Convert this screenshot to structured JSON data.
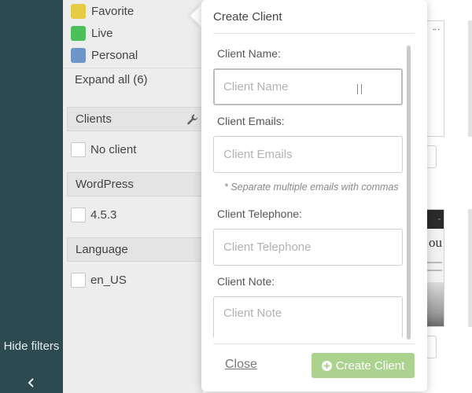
{
  "sidebar": {
    "hide_filters_label": "Hide filters",
    "hide_filters_icon": "chevron-left-icon"
  },
  "filters": {
    "tags": [
      {
        "label": "Favorite",
        "color": "#e6cc45"
      },
      {
        "label": "Live",
        "color": "#4dbf5a"
      },
      {
        "label": "Personal",
        "color": "#6f94c7"
      }
    ],
    "expand_all_label": "Expand all (6)",
    "sections": [
      {
        "title": "Clients",
        "icon": "wrench-icon",
        "options": [
          "No client"
        ]
      },
      {
        "title": "WordPress",
        "options": [
          "4.5.3"
        ]
      },
      {
        "title": "Language",
        "options": [
          "en_US"
        ]
      }
    ]
  },
  "background": {
    "thumb_text": "ou"
  },
  "popover": {
    "title": "Create Client",
    "fields": [
      {
        "label": "Client Name:",
        "placeholder": "Client Name"
      },
      {
        "label": "Client Emails:",
        "placeholder": "Client Emails"
      },
      {
        "label": "Client Telephone:",
        "placeholder": "Client Telephone"
      },
      {
        "label": "Client Note:",
        "placeholder": "Client Note"
      }
    ],
    "email_hint": "* Separate multiple emails with commas",
    "close_label": "Close",
    "create_label": "Create Client",
    "create_button_color": "#acd28f"
  }
}
